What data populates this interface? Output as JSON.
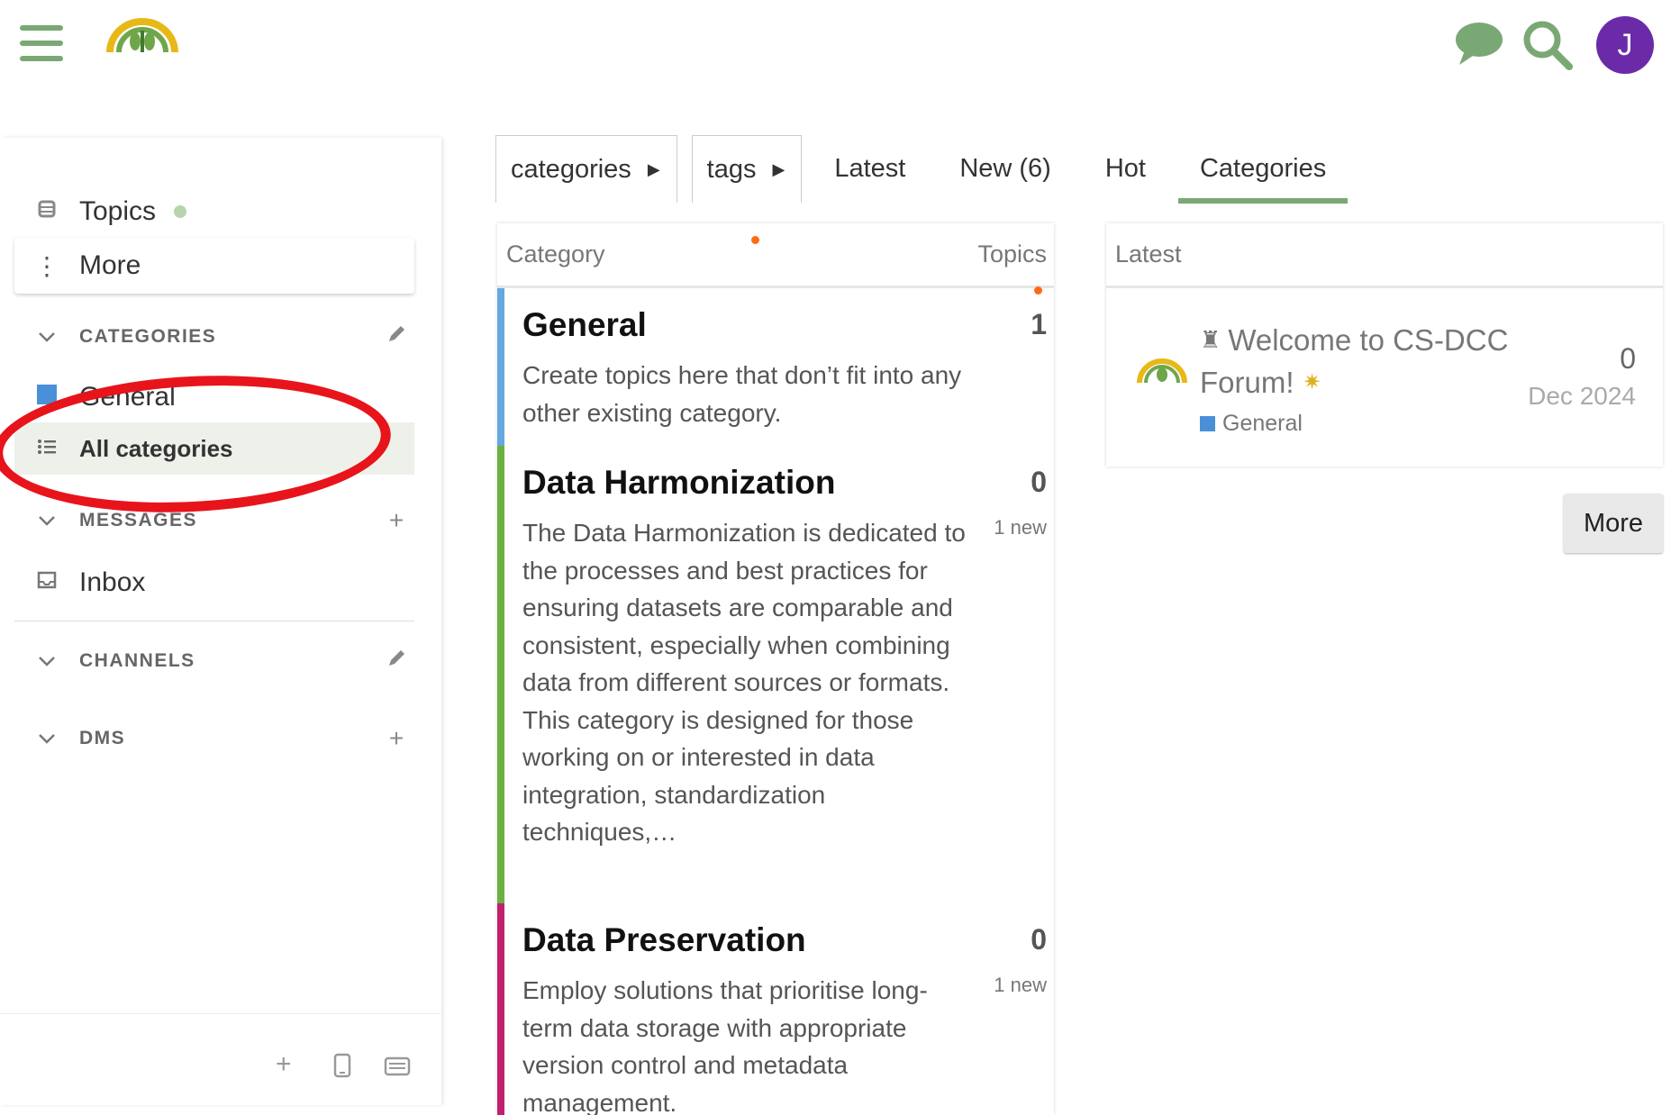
{
  "header": {
    "menu_icon": "hamburger-icon",
    "logo_icon": "forum-logo-icon",
    "chat_icon": "chat-icon",
    "search_icon": "search-icon",
    "avatar_letter": "J",
    "avatar_color": "#6b2ba8"
  },
  "sidebar": {
    "topics_label": "Topics",
    "more_label": "More",
    "categories_section": "CATEGORIES",
    "general_label": "General",
    "all_categories_label": "All categories",
    "messages_section": "MESSAGES",
    "inbox_label": "Inbox",
    "channels_section": "CHANNELS",
    "dms_section": "DMS"
  },
  "nav": {
    "categories_dropdown": "categories",
    "tags_dropdown": "tags",
    "tabs": [
      "Latest",
      "New (6)",
      "Hot",
      "Categories"
    ],
    "active_tab": "Categories"
  },
  "categories_table": {
    "col_category": "Category",
    "col_topics": "Topics",
    "rows": [
      {
        "name": "General",
        "description": "Create topics here that don’t fit into any other existing category.",
        "topics": "1",
        "new": "",
        "color": "#65a8e0"
      },
      {
        "name": "Data Harmonization",
        "description": "The Data Harmonization is dedicated to the processes and best practices for ensuring datasets are comparable and consistent, especially when combining data from different sources or formats. This category is designed for those working on or interested in data integration, standardization techniques,…",
        "topics": "0",
        "new": "1 new",
        "color": "#6cb043"
      },
      {
        "name": "Data Preservation",
        "description": "Employ solutions that prioritise long-term data storage with appropriate version control and metadata management.",
        "topics": "0",
        "new": "1 new",
        "color": "#c0206e"
      }
    ]
  },
  "latest": {
    "heading": "Latest",
    "topic": {
      "title_line1": "Welcome to CS-DCC",
      "title_line2": "Forum!",
      "category": "General",
      "category_color": "#4a90d9",
      "replies": "0",
      "date": "Dec 2024"
    },
    "more_button": "More"
  },
  "colors": {
    "accent_green": "#7aa874",
    "annotation_red": "#e8141b",
    "new_dot_orange": "#ff6a16"
  }
}
